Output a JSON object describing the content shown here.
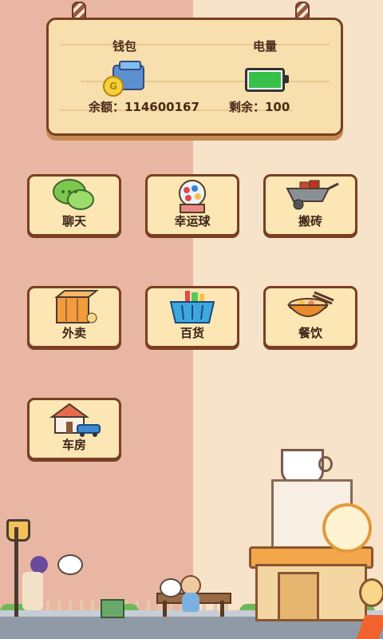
{
  "sign": {
    "wallet_title": "钱包",
    "power_title": "电量",
    "balance_text": "余额：114600167",
    "remaining_text": "剩余：100",
    "coin_symbol": "G",
    "battery_level": 1.0
  },
  "tiles": [
    {
      "label": "聊天"
    },
    {
      "label": "幸运球"
    },
    {
      "label": "搬砖"
    },
    {
      "label": "外卖"
    },
    {
      "label": "百货"
    },
    {
      "label": "餐饮"
    },
    {
      "label": "车房"
    }
  ],
  "colors": {
    "left_background": "#e8b6a2",
    "right_background": "#f6e3c9",
    "tile_face": "#fbe6b4",
    "tile_border": "#7a3f22",
    "tile_stripe": "#f5a623",
    "battery_fill": "#35c04a"
  },
  "icons": [
    "chat-bubbles-icon",
    "lucky-ball-machine-icon",
    "wheelbarrow-bricks-icon",
    "delivery-box-icon",
    "shopping-basket-icon",
    "food-bowl-icon",
    "house-car-icon",
    "wallet-icon",
    "coin-icon",
    "battery-icon"
  ]
}
